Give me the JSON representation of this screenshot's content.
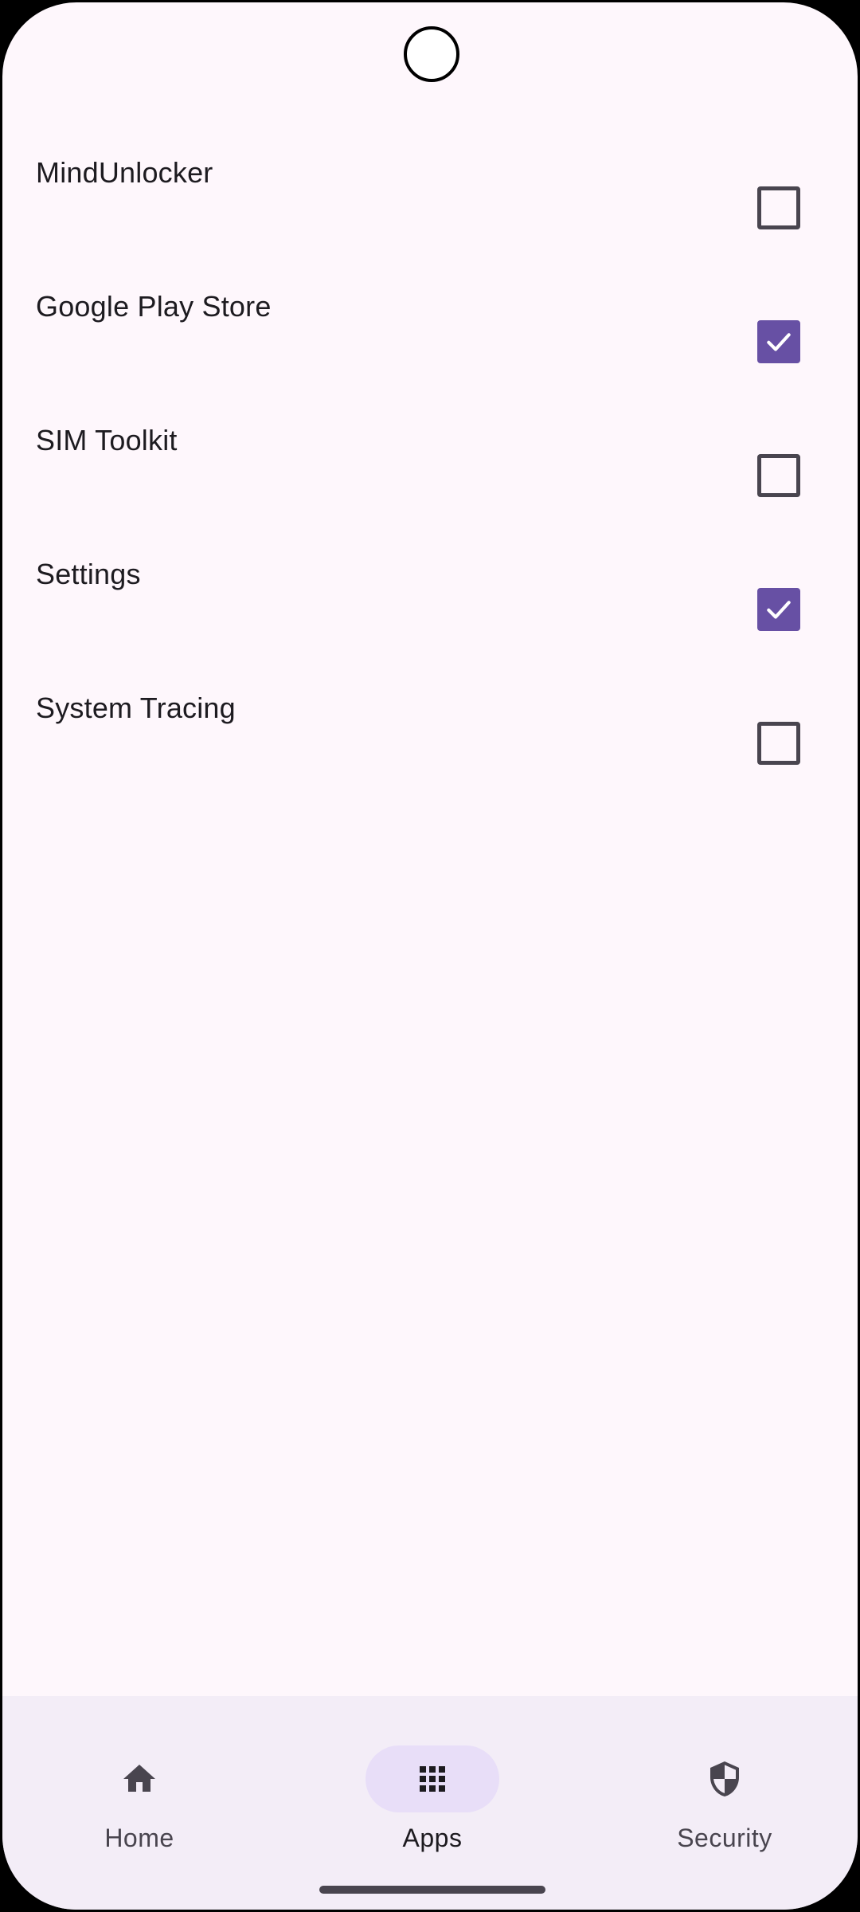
{
  "apps": [
    {
      "name": "MindUnlocker",
      "checked": false
    },
    {
      "name": "Google Play Store",
      "checked": true
    },
    {
      "name": "SIM Toolkit",
      "checked": false
    },
    {
      "name": "Settings",
      "checked": true
    },
    {
      "name": "System Tracing",
      "checked": false
    }
  ],
  "bottom_nav": {
    "items": [
      {
        "label": "Home",
        "icon": "home-icon",
        "active": false
      },
      {
        "label": "Apps",
        "icon": "apps-grid-icon",
        "active": true
      },
      {
        "label": "Security",
        "icon": "shield-icon",
        "active": false
      }
    ]
  },
  "colors": {
    "accent": "#6750a4",
    "background": "#fef7fc",
    "nav_background": "#f3edf7",
    "nav_indicator": "#e8def8"
  }
}
